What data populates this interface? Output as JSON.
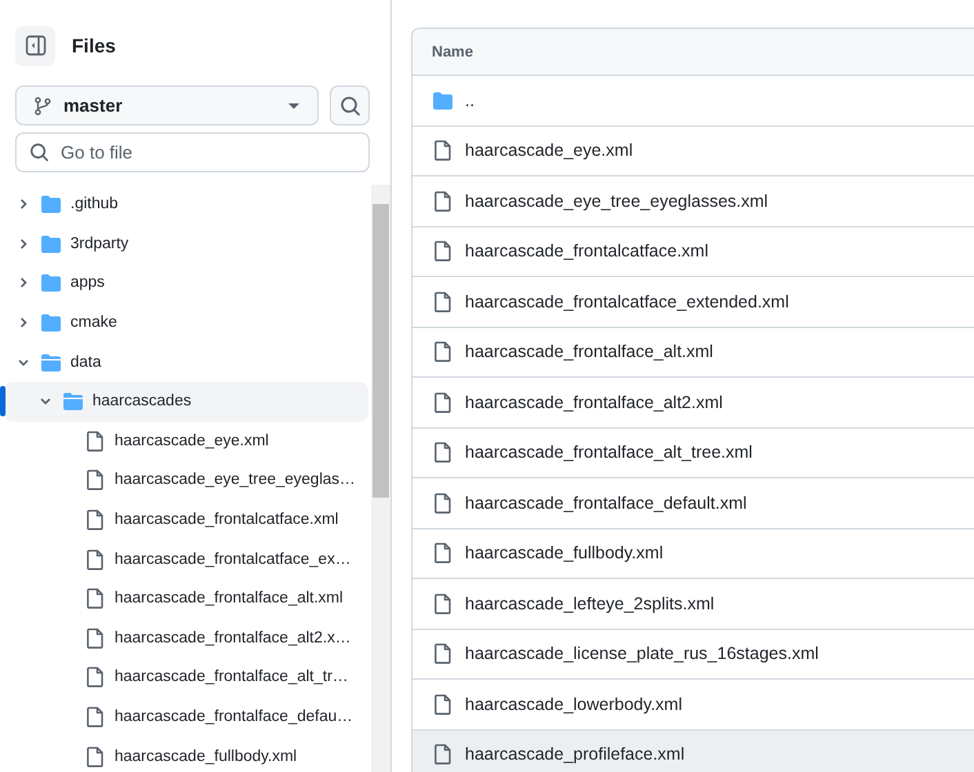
{
  "sidebar": {
    "title": "Files",
    "branch": "master",
    "search": {
      "placeholder": "Go to file"
    },
    "tree": [
      {
        "kind": "folder",
        "name": ".github",
        "expanded": false,
        "selected": false
      },
      {
        "kind": "folder",
        "name": "3rdparty",
        "expanded": false,
        "selected": false
      },
      {
        "kind": "folder",
        "name": "apps",
        "expanded": false,
        "selected": false
      },
      {
        "kind": "folder",
        "name": "cmake",
        "expanded": false,
        "selected": false
      },
      {
        "kind": "folder",
        "name": "data",
        "expanded": true,
        "selected": false,
        "children": [
          {
            "kind": "folder",
            "name": "haarcascades",
            "expanded": true,
            "selected": true,
            "children": [
              {
                "kind": "file",
                "name": "haarcascade_eye.xml",
                "selected": false
              },
              {
                "kind": "file",
                "name": "haarcascade_eye_tree_eyeglas…",
                "selected": false
              },
              {
                "kind": "file",
                "name": "haarcascade_frontalcatface.xml",
                "selected": false
              },
              {
                "kind": "file",
                "name": "haarcascade_frontalcatface_ex…",
                "selected": false
              },
              {
                "kind": "file",
                "name": "haarcascade_frontalface_alt.xml",
                "selected": false
              },
              {
                "kind": "file",
                "name": "haarcascade_frontalface_alt2.x…",
                "selected": false
              },
              {
                "kind": "file",
                "name": "haarcascade_frontalface_alt_tr…",
                "selected": false
              },
              {
                "kind": "file",
                "name": "haarcascade_frontalface_defau…",
                "selected": false
              },
              {
                "kind": "file",
                "name": "haarcascade_fullbody.xml",
                "selected": false
              }
            ]
          }
        ]
      }
    ]
  },
  "table": {
    "columns": [
      "Name"
    ],
    "rows": [
      {
        "kind": "folder",
        "name": "..",
        "highlighted": false
      },
      {
        "kind": "file",
        "name": "haarcascade_eye.xml",
        "highlighted": false
      },
      {
        "kind": "file",
        "name": "haarcascade_eye_tree_eyeglasses.xml",
        "highlighted": false
      },
      {
        "kind": "file",
        "name": "haarcascade_frontalcatface.xml",
        "highlighted": false
      },
      {
        "kind": "file",
        "name": "haarcascade_frontalcatface_extended.xml",
        "highlighted": false
      },
      {
        "kind": "file",
        "name": "haarcascade_frontalface_alt.xml",
        "highlighted": false
      },
      {
        "kind": "file",
        "name": "haarcascade_frontalface_alt2.xml",
        "highlighted": false
      },
      {
        "kind": "file",
        "name": "haarcascade_frontalface_alt_tree.xml",
        "highlighted": false
      },
      {
        "kind": "file",
        "name": "haarcascade_frontalface_default.xml",
        "highlighted": false
      },
      {
        "kind": "file",
        "name": "haarcascade_fullbody.xml",
        "highlighted": false
      },
      {
        "kind": "file",
        "name": "haarcascade_lefteye_2splits.xml",
        "highlighted": false
      },
      {
        "kind": "file",
        "name": "haarcascade_license_plate_rus_16stages.xml",
        "highlighted": false
      },
      {
        "kind": "file",
        "name": "haarcascade_lowerbody.xml",
        "highlighted": false
      },
      {
        "kind": "file",
        "name": "haarcascade_profileface.xml",
        "highlighted": true
      }
    ]
  }
}
